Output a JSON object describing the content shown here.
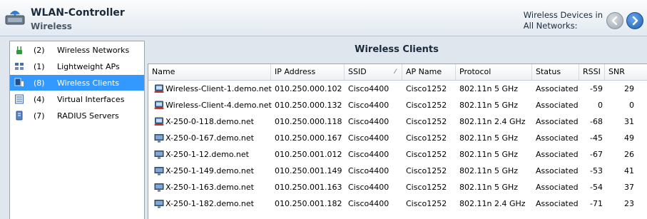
{
  "header": {
    "title": "WLAN-Controller",
    "subtitle": "Wireless",
    "devices_line1": "Wireless Devices in",
    "devices_line2": "All Networks:",
    "app_icon": "wireless-router-icon",
    "back_icon": "arrow-left-icon",
    "forward_icon": "arrow-right-icon"
  },
  "sidebar": {
    "items": [
      {
        "count": "(2)",
        "label": "Wireless Networks",
        "icon": "network-icon",
        "selected": false
      },
      {
        "count": "(1)",
        "label": "Lightweight APs",
        "icon": "access-point-icon",
        "selected": false
      },
      {
        "count": "(8)",
        "label": "Wireless Clients",
        "icon": "client-icon",
        "selected": true
      },
      {
        "count": "(4)",
        "label": "Virtual Interfaces",
        "icon": "interface-icon",
        "selected": false
      },
      {
        "count": "(7)",
        "label": "RADIUS Servers",
        "icon": "server-icon",
        "selected": false
      }
    ]
  },
  "main": {
    "title": "Wireless Clients",
    "columns": [
      "Name",
      "IP Address",
      "SSID",
      "AP Name",
      "Protocol",
      "Status",
      "RSSI",
      "SNR"
    ],
    "sort_column": "SSID",
    "sort_icon": "sort-icon",
    "rows": [
      {
        "name": "Wireless-Client-1.demo.net",
        "ip": "010.250.000.102",
        "ssid": "Cisco4400",
        "ap": "Cisco1252",
        "protocol": "802.11n 5 GHz",
        "status": "Associated",
        "rssi": "-59",
        "snr": "29",
        "icon": "laptop-icon"
      },
      {
        "name": "Wireless-Client-4.demo.net",
        "ip": "010.250.000.132",
        "ssid": "Cisco4400",
        "ap": "Cisco1252",
        "protocol": "802.11n 5 GHz",
        "status": "Associated",
        "rssi": "0",
        "snr": "0",
        "icon": "laptop-icon"
      },
      {
        "name": "X-250-0-118.demo.net",
        "ip": "010.250.000.118",
        "ssid": "Cisco4400",
        "ap": "Cisco1252",
        "protocol": "802.11n 2.4 GHz",
        "status": "Associated",
        "rssi": "-68",
        "snr": "31",
        "icon": "laptop-icon"
      },
      {
        "name": "X-250-0-167.demo.net",
        "ip": "010.250.000.167",
        "ssid": "Cisco4400",
        "ap": "Cisco1252",
        "protocol": "802.11n 5 GHz",
        "status": "Associated",
        "rssi": "-45",
        "snr": "49",
        "icon": "monitor-icon"
      },
      {
        "name": "X-250-1-12.demo.net",
        "ip": "010.250.001.012",
        "ssid": "Cisco4400",
        "ap": "Cisco1252",
        "protocol": "802.11n 5 GHz",
        "status": "Associated",
        "rssi": "-67",
        "snr": "26",
        "icon": "monitor-icon"
      },
      {
        "name": "X-250-1-149.demo.net",
        "ip": "010.250.001.149",
        "ssid": "Cisco4400",
        "ap": "Cisco1252",
        "protocol": "802.11n 5 GHz",
        "status": "Associated",
        "rssi": "-53",
        "snr": "41",
        "icon": "monitor-icon"
      },
      {
        "name": "X-250-1-163.demo.net",
        "ip": "010.250.001.163",
        "ssid": "Cisco4400",
        "ap": "Cisco1252",
        "protocol": "802.11n 5 GHz",
        "status": "Associated",
        "rssi": "-54",
        "snr": "37",
        "icon": "monitor-icon"
      },
      {
        "name": "X-250-1-182.demo.net",
        "ip": "010.250.001.182",
        "ssid": "Cisco4400",
        "ap": "Cisco1252",
        "protocol": "802.11n 2.4 GHz",
        "status": "Associated",
        "rssi": "-71",
        "snr": "23",
        "icon": "monitor-icon"
      }
    ]
  },
  "colors": {
    "selection": "#3399ff",
    "background": "#dfe6ee"
  }
}
